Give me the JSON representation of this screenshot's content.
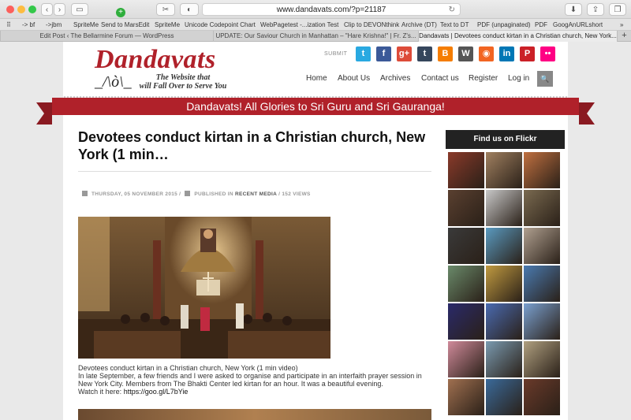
{
  "browser": {
    "url": "www.dandavats.com/?p=21187",
    "bookmarks": [
      "-> bf",
      "->jbm",
      "SpriteMe",
      "Send to MarsEdit",
      "SpriteMe",
      "Unicode Codepoint Chart",
      "WebPagetest -...ization Test",
      "Clip to DEVONthink",
      "Archive (DT)",
      "Text to DT",
      "PDF (unpaginated)",
      "PDF",
      "GoogAnURLshort"
    ],
    "tabs": [
      "Edit Post ‹ The Bellarmine Forum — WordPress",
      "UPDATE: Our Saviour Church in Manhattan – \"Hare Krishna!\" | Fr. Z's...",
      "Dandavats | Devotees conduct kirtan in a Christian church, New York..."
    ],
    "new_tab": "+"
  },
  "site": {
    "logo_title": "Dandavats",
    "logo_mark": "_/\\ò\\_",
    "tagline_line1": "The Website that",
    "tagline_line2": "will Fall Over to Serve You",
    "submit_label": "SUBMIT",
    "social": [
      {
        "icon": "twitter-icon",
        "glyph": "t",
        "color": "#29a9e1"
      },
      {
        "icon": "facebook-icon",
        "glyph": "f",
        "color": "#3b5998"
      },
      {
        "icon": "google-plus-icon",
        "glyph": "g+",
        "color": "#dd4b39"
      },
      {
        "icon": "tumblr-icon",
        "glyph": "t",
        "color": "#35465c"
      },
      {
        "icon": "blogger-icon",
        "glyph": "B",
        "color": "#f57d00"
      },
      {
        "icon": "wordpress-icon",
        "glyph": "W",
        "color": "#555555"
      },
      {
        "icon": "rss-icon",
        "glyph": "◉",
        "color": "#f26522"
      },
      {
        "icon": "linkedin-icon",
        "glyph": "in",
        "color": "#0077b5"
      },
      {
        "icon": "pinterest-icon",
        "glyph": "P",
        "color": "#cb2027"
      },
      {
        "icon": "flickr-icon",
        "glyph": "••",
        "color": "#ff0084"
      }
    ],
    "nav": [
      "Home",
      "About Us",
      "Archives",
      "Contact us",
      "Register",
      "Log in"
    ],
    "search_glyph": "🔍",
    "ribbon": "Dandavats! All Glories to Sri Guru and Sri Gauranga!"
  },
  "post": {
    "title": "Devotees conduct kirtan in a Christian church, New York (1 min…",
    "date": "THURSDAY, 05 NOVEMBER 2015",
    "published_in_prefix": "PUBLISHED IN",
    "category": "RECENT MEDIA",
    "views": "152 VIEWS",
    "caption": "Devotees conduct kirtan in a Christian church, New York (1 min video)",
    "paragraph": "In late September, a few friends and I were asked to organise and participate in an interfaith prayer session in New York City. Members from The Bhakti Center led kirtan for an hour. It was a beautiful evening.",
    "watch_prefix": "Watch it here:",
    "link": "https://goo.gl/L7bYie"
  },
  "sidebar": {
    "flickr_heading": "Find us on Flickr",
    "thumb_colors": [
      "#8a3a2a",
      "#a08060",
      "#c07040",
      "#5a4030",
      "#c8c8c8",
      "#7a6a50",
      "#3a3a3a",
      "#5a9ac0",
      "#b0a090",
      "#6a8a6a",
      "#c09a40",
      "#4a7ab0",
      "#2a2a6a",
      "#4a6ab0",
      "#7aa0d0",
      "#d08a9a",
      "#7a9ab0",
      "#b0a080",
      "#a07050",
      "#3a6a9a",
      "#6a3a2a"
    ]
  }
}
